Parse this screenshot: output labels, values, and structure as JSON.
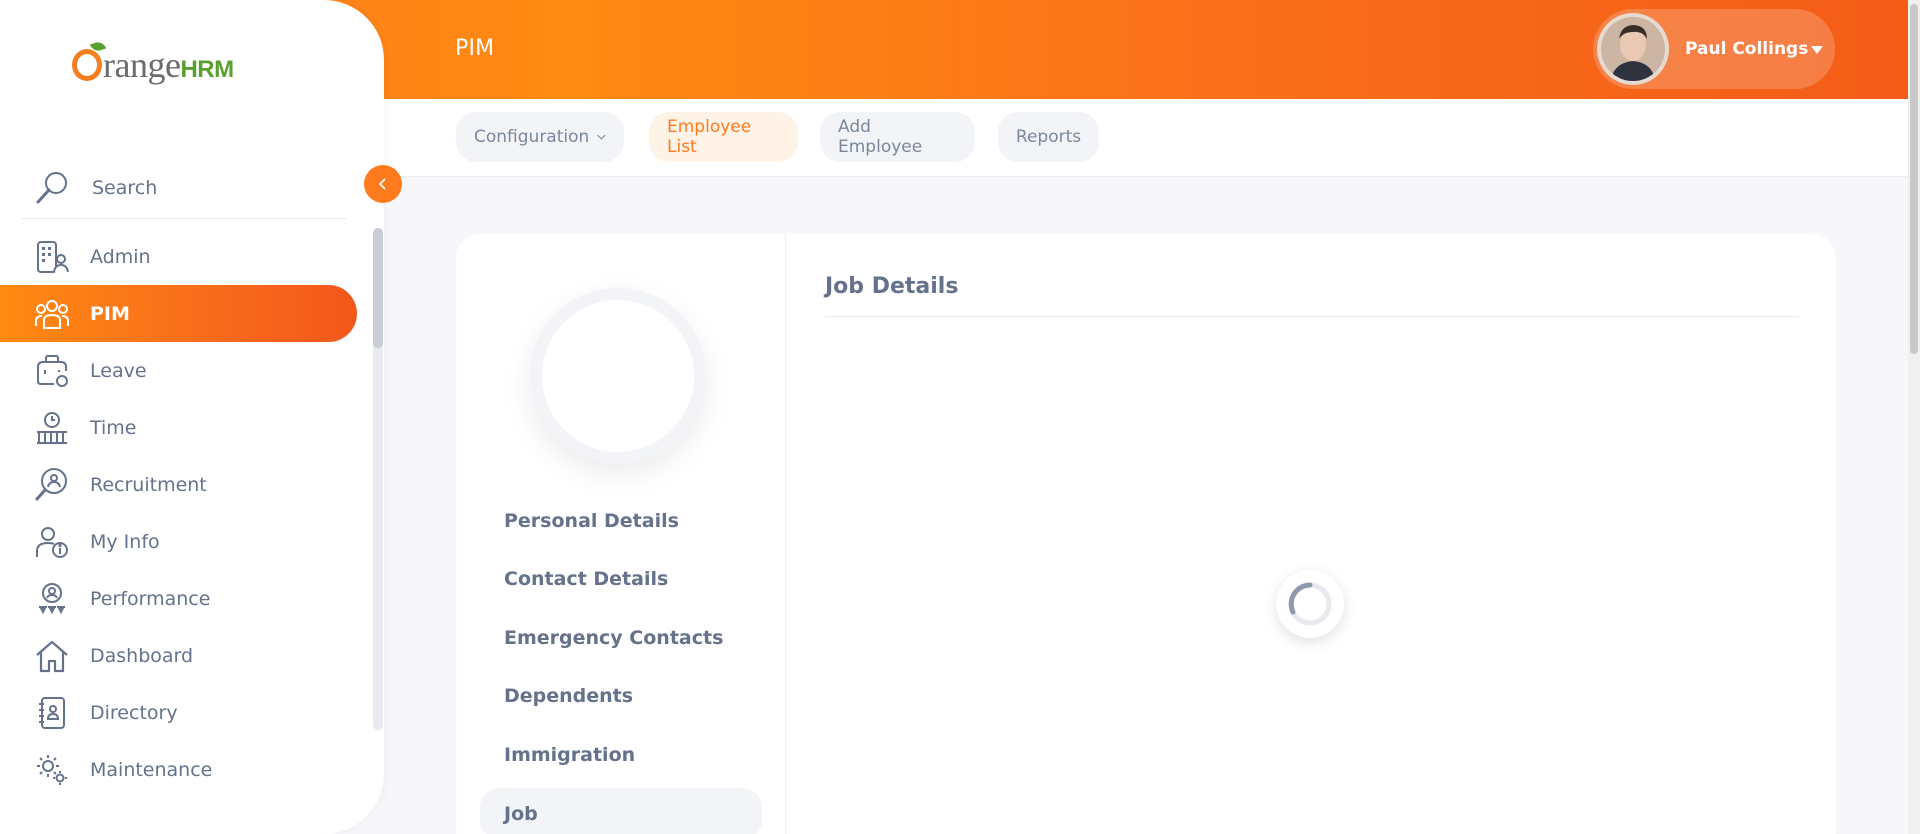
{
  "header": {
    "module_title": "PIM",
    "user_name": "Paul Collings",
    "avatar_icon": "user-avatar-photo",
    "dropdown_icon": "caret-down-icon",
    "accent_color": "#ff7b1d"
  },
  "subnav": {
    "tabs": [
      {
        "label": "Configuration",
        "has_dropdown": true,
        "active": false
      },
      {
        "label": "Employee List",
        "active": true
      },
      {
        "label": "Add Employee",
        "active": false
      },
      {
        "label": "Reports",
        "active": false
      }
    ]
  },
  "sidebar": {
    "logo_text": "Orange",
    "logo_suffix": "HRM",
    "search_label": "Search",
    "collapse_icon": "chevron-left-icon",
    "items": [
      {
        "label": "Admin",
        "icon": "admin-icon",
        "active": false
      },
      {
        "label": "PIM",
        "icon": "pim-icon",
        "active": true
      },
      {
        "label": "Leave",
        "icon": "leave-icon",
        "active": false
      },
      {
        "label": "Time",
        "icon": "time-icon",
        "active": false
      },
      {
        "label": "Recruitment",
        "icon": "recruitment-icon",
        "active": false
      },
      {
        "label": "My Info",
        "icon": "my-info-icon",
        "active": false
      },
      {
        "label": "Performance",
        "icon": "performance-icon",
        "active": false
      },
      {
        "label": "Dashboard",
        "icon": "dashboard-icon",
        "active": false
      },
      {
        "label": "Directory",
        "icon": "directory-icon",
        "active": false
      },
      {
        "label": "Maintenance",
        "icon": "maintenance-icon",
        "active": false
      }
    ]
  },
  "employee_tabs": [
    {
      "label": "Personal Details"
    },
    {
      "label": "Contact Details"
    },
    {
      "label": "Emergency Contacts"
    },
    {
      "label": "Dependents"
    },
    {
      "label": "Immigration"
    },
    {
      "label": "Job",
      "active": true
    }
  ],
  "content": {
    "section_title": "Job Details",
    "loading_icon": "spinner-icon"
  }
}
